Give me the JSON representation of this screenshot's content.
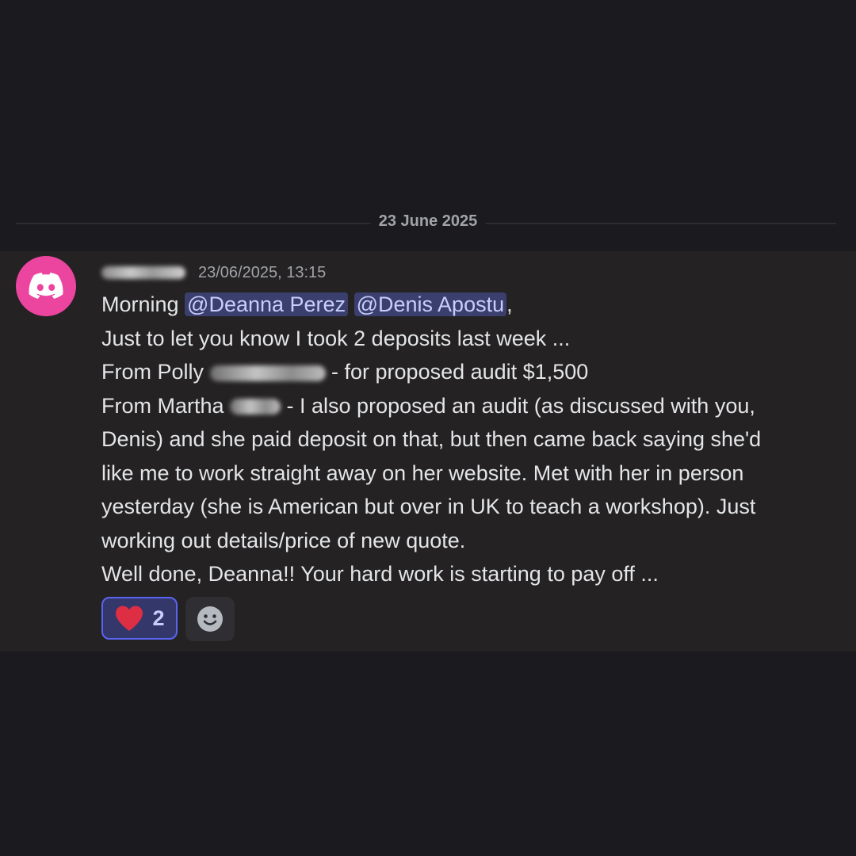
{
  "divider": {
    "date_label": "23 June 2025"
  },
  "message": {
    "author_name": "",
    "avatar_icon": "discord-logo-icon",
    "avatar_color": "#eb459f",
    "timestamp": "23/06/2025, 13:15",
    "line1": {
      "prefix": "Morning ",
      "mention1": "@Deanna Perez",
      "mention2": "@Denis Apostu",
      "suffix": ","
    },
    "line2": "Just to let you know I took 2 deposits last week ...",
    "line3": {
      "prefix": "From Polly ",
      "suffix": " - for proposed audit $1,500"
    },
    "line4": {
      "prefix": "From Martha ",
      "suffix": " - I also proposed an audit (as discussed with you,"
    },
    "line5": "Denis) and she paid deposit on that, but then came back saying she'd",
    "line6": "like me to work straight away on her website. Met with her in person",
    "line7": "yesterday (she is American but over in UK to teach a workshop). Just",
    "line8": "working out details/price of new quote.",
    "line9": "Well done, Deanna!! Your hard work is starting to pay off ..."
  },
  "reactions": [
    {
      "emoji": "heart-icon",
      "count": "2",
      "active": true
    }
  ],
  "add_reaction": {
    "icon": "smiley-face-icon"
  },
  "colors": {
    "background": "#1a1a1f",
    "message_background": "#242222",
    "mention_background": "#3b3f6e",
    "mention_text": "#c9cdfb",
    "accent": "#5865f2"
  }
}
